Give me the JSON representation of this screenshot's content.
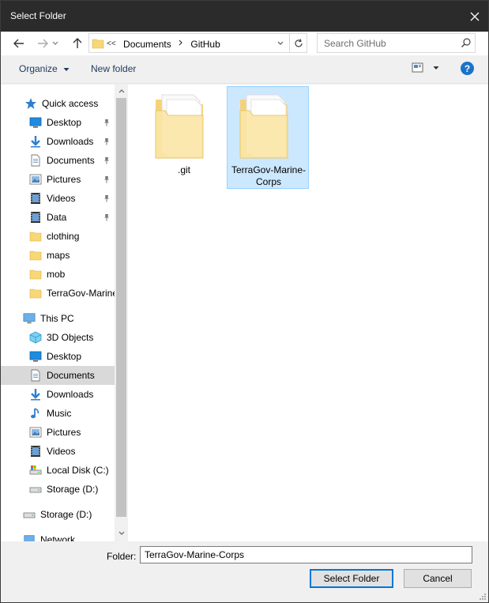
{
  "window": {
    "title": "Select Folder"
  },
  "address": {
    "prefix": "<<",
    "crumbs": [
      "Documents",
      "GitHub"
    ]
  },
  "search": {
    "placeholder": "Search GitHub"
  },
  "commandbar": {
    "organize_label": "Organize",
    "new_folder_label": "New folder",
    "help_label": "?"
  },
  "sidebar": {
    "quick_access": "Quick access",
    "quick_items": [
      {
        "label": "Desktop",
        "icon": "desktop-icon",
        "pinned": true
      },
      {
        "label": "Downloads",
        "icon": "downloads-icon",
        "pinned": true
      },
      {
        "label": "Documents",
        "icon": "documents-icon",
        "pinned": true
      },
      {
        "label": "Pictures",
        "icon": "pictures-icon",
        "pinned": true
      },
      {
        "label": "Videos",
        "icon": "videos-icon",
        "pinned": true
      },
      {
        "label": "Data",
        "icon": "videos-icon",
        "pinned": true
      },
      {
        "label": "clothing",
        "icon": "folder-icon",
        "pinned": false
      },
      {
        "label": "maps",
        "icon": "folder-icon",
        "pinned": false
      },
      {
        "label": "mob",
        "icon": "folder-icon",
        "pinned": false
      },
      {
        "label": "TerraGov-Marine",
        "icon": "folder-icon",
        "pinned": false
      }
    ],
    "this_pc": "This PC",
    "pc_items": [
      {
        "label": "3D Objects",
        "icon": "3d-objects-icon"
      },
      {
        "label": "Desktop",
        "icon": "desktop-icon"
      },
      {
        "label": "Documents",
        "icon": "documents-icon",
        "selected": true
      },
      {
        "label": "Downloads",
        "icon": "downloads-icon"
      },
      {
        "label": "Music",
        "icon": "music-icon"
      },
      {
        "label": "Pictures",
        "icon": "pictures-icon"
      },
      {
        "label": "Videos",
        "icon": "videos-icon"
      },
      {
        "label": "Local Disk (C:)",
        "icon": "local-disk-icon"
      },
      {
        "label": "Storage (D:)",
        "icon": "drive-icon"
      }
    ],
    "storage_root": "Storage (D:)",
    "network": "Network"
  },
  "files": [
    {
      "name": ".git",
      "selected": false
    },
    {
      "name": "TerraGov-Marine-Corps",
      "selected": true
    }
  ],
  "footer": {
    "folder_label": "Folder:",
    "folder_value": "TerraGov-Marine-Corps",
    "select_button": "Select Folder",
    "cancel_button": "Cancel"
  },
  "colors": {
    "titlebar": "#2b2b2b",
    "selection": "#cce8ff",
    "accent": "#0078d7",
    "folder": "#f8d775"
  }
}
